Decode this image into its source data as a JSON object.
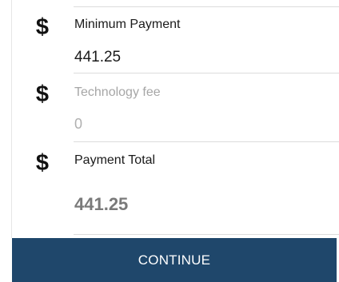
{
  "fields": [
    {
      "icon": "dollar-icon",
      "symbol": "$",
      "label": "Minimum Payment",
      "value": "441.25",
      "state": "normal"
    },
    {
      "icon": "dollar-icon",
      "symbol": "$",
      "label": "Technology fee",
      "value": "0",
      "state": "disabled"
    },
    {
      "icon": "dollar-icon",
      "symbol": "$",
      "label": "Payment Total",
      "value": "441.25",
      "state": "total"
    }
  ],
  "actions": {
    "continue_label": "CONTINUE"
  },
  "colors": {
    "button_bg": "#1f476b",
    "button_text": "#ffffff",
    "label_disabled": "#a6a6a6",
    "total_value": "#7a7a7a"
  }
}
